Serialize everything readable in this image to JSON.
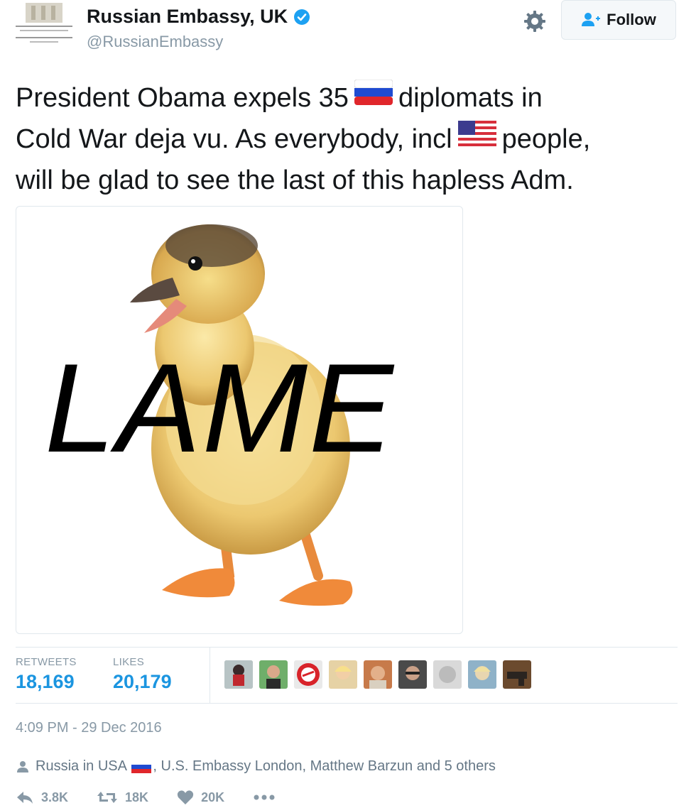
{
  "header": {
    "display_name": "Russian Embassy, UK",
    "handle": "@RussianEmbassy",
    "follow_label": "Follow",
    "verified_color": "#1da1f2"
  },
  "tweet": {
    "line1_a": "President Obama expels 35",
    "line1_b": "diplomats in",
    "line2_a": "Cold War deja vu. As everybody, incl",
    "line2_b": "people,",
    "line3": "will be glad to see the last of this hapless Adm.",
    "image_text": "LAME"
  },
  "stats": {
    "retweets_label": "RETWEETS",
    "retweets_value": "18,169",
    "likes_label": "LIKES",
    "likes_value": "20,179"
  },
  "timestamp": "4:09 PM - 29 Dec 2016",
  "context": {
    "prefix": "Russia in USA",
    "rest": ", U.S. Embassy London, Matthew Barzun and 5 others"
  },
  "actions": {
    "reply_count": "3.8K",
    "retweet_count": "18K",
    "like_count": "20K"
  },
  "colors": {
    "link_blue": "#1b95e0",
    "muted": "#8899a6",
    "border": "#e1e8ed"
  }
}
